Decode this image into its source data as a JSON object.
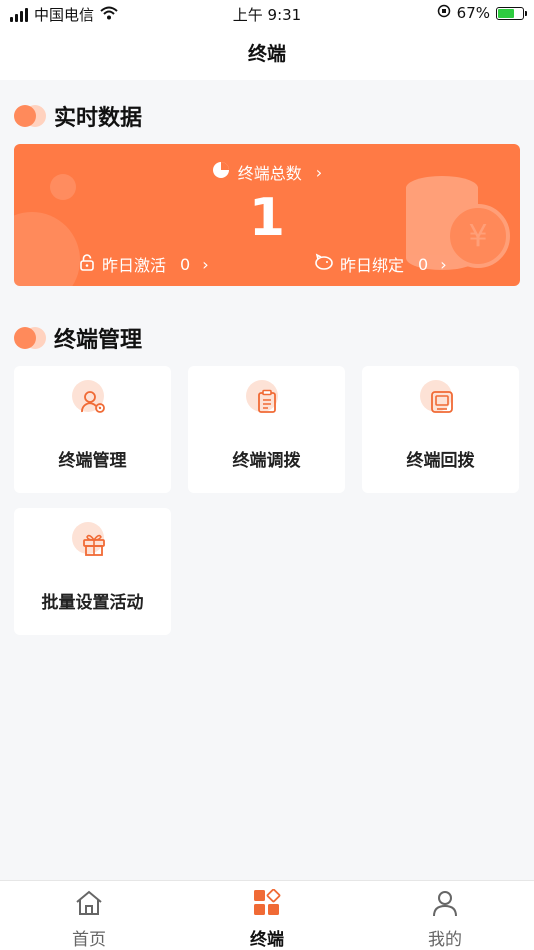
{
  "status_bar": {
    "carrier": "中国电信",
    "time": "上午 9:31",
    "battery_percent": "67%"
  },
  "nav": {
    "title": "终端"
  },
  "realtime": {
    "section_title": "实时数据",
    "total_label": "终端总数",
    "total_value": "1",
    "yesterday_activated_label": "昨日激活",
    "yesterday_activated_value": "0",
    "yesterday_bound_label": "昨日绑定",
    "yesterday_bound_value": "0"
  },
  "management": {
    "section_title": "终端管理",
    "tiles": [
      {
        "label": "终端管理",
        "icon": "user-gear-icon"
      },
      {
        "label": "终端调拨",
        "icon": "clipboard-icon"
      },
      {
        "label": "终端回拨",
        "icon": "monitor-icon"
      },
      {
        "label": "批量设置活动",
        "icon": "gift-icon"
      }
    ]
  },
  "tabbar": {
    "items": [
      {
        "label": "首页",
        "icon": "home-icon"
      },
      {
        "label": "终端",
        "icon": "grid-icon"
      },
      {
        "label": "我的",
        "icon": "person-icon"
      }
    ]
  },
  "colors": {
    "accent": "#ff7a45",
    "accent_light": "#fde2d6"
  }
}
